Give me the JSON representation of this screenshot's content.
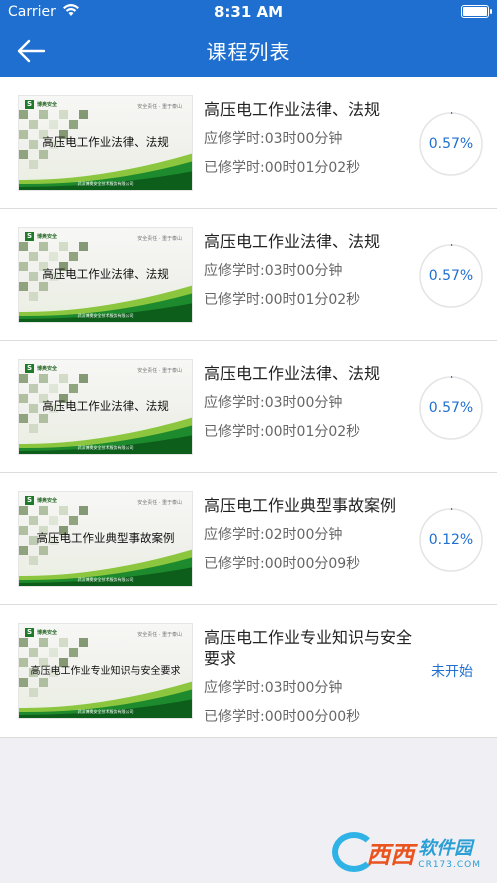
{
  "status": {
    "carrier": "Carrier",
    "time": "8:31 AM"
  },
  "nav": {
    "title": "课程列表"
  },
  "colors": {
    "accent": "#1e6fd0",
    "progress_track": "#e4e4e4",
    "brand_green": "#1e7a2a"
  },
  "thumb_common": {
    "logo": "博奥安全",
    "slogan": "安全责任 · 重于泰山",
    "footer": "武汉博奥安全技术服务有限公司"
  },
  "courses": [
    {
      "title": "高压电工作业法律、法规",
      "thumb_title": "高压电工作业法律、法规",
      "required": "应修学时:03时00分钟",
      "studied": "已修学时:00时01分02秒",
      "progress": 0.57,
      "progress_label": "0.57%"
    },
    {
      "title": "高压电工作业法律、法规",
      "thumb_title": "高压电工作业法律、法规",
      "required": "应修学时:03时00分钟",
      "studied": "已修学时:00时01分02秒",
      "progress": 0.57,
      "progress_label": "0.57%"
    },
    {
      "title": "高压电工作业法律、法规",
      "thumb_title": "高压电工作业法律、法规",
      "required": "应修学时:03时00分钟",
      "studied": "已修学时:00时01分02秒",
      "progress": 0.57,
      "progress_label": "0.57%"
    },
    {
      "title": "高压电工作业典型事故案例",
      "thumb_title": "高压电工作业典型事故案例",
      "required": "应修学时:02时00分钟",
      "studied": "已修学时:00时00分09秒",
      "progress": 0.12,
      "progress_label": "0.12%"
    },
    {
      "title": "高压电工作业专业知识与安全要求",
      "thumb_title": "高压电工作业专业知识与安全要求",
      "required": "应修学时:03时00分钟",
      "studied": "已修学时:00时00分00秒",
      "progress": 0,
      "status_label": "未开始"
    }
  ],
  "watermark": {
    "brand": "西西",
    "site": "软件园",
    "domain": "CR173.COM"
  }
}
